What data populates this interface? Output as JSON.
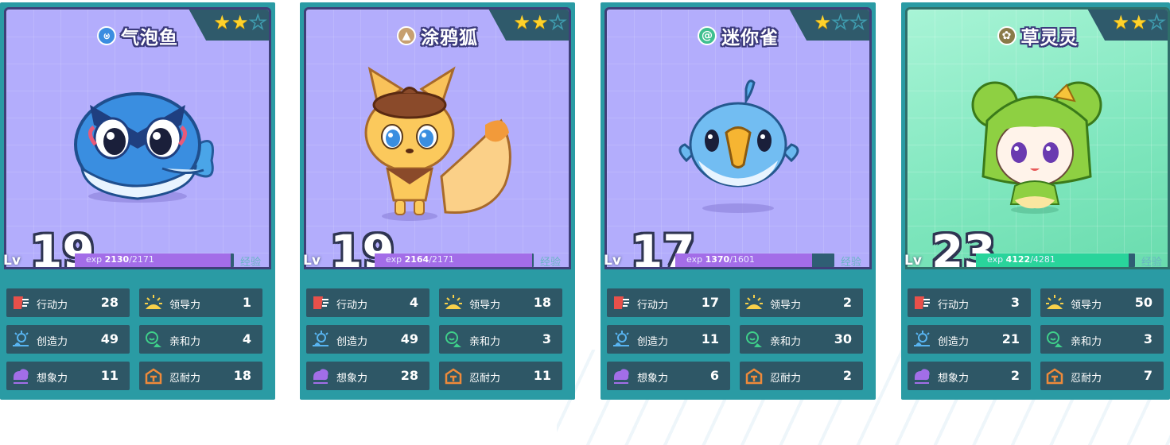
{
  "labels": {
    "lv": "Lv",
    "exp": "exp",
    "exp_side": "经验"
  },
  "stat_names": {
    "action": "行动力",
    "lead": "领导力",
    "create": "创造力",
    "affinity": "亲和力",
    "imagine": "想象力",
    "endure": "忍耐力"
  },
  "cards": [
    {
      "name": "气泡鱼",
      "type_icon": "water-swirl-icon",
      "type_color": "#3b8de0",
      "stars_filled": 2,
      "stars_total": 3,
      "level": "19",
      "exp_current": "2130",
      "exp_sep": "/",
      "exp_max": "2171",
      "exp_fraction": 0.98,
      "theme": "purple",
      "stats": {
        "action": "28",
        "lead": "1",
        "create": "49",
        "affinity": "4",
        "imagine": "11",
        "endure": "18"
      }
    },
    {
      "name": "涂鸦狐",
      "type_icon": "ground-icon",
      "type_color": "#c7a070",
      "stars_filled": 2,
      "stars_total": 3,
      "level": "19",
      "exp_current": "2164",
      "exp_sep": "/",
      "exp_max": "2171",
      "exp_fraction": 0.99,
      "theme": "purple",
      "stats": {
        "action": "4",
        "lead": "18",
        "create": "49",
        "affinity": "3",
        "imagine": "28",
        "endure": "11"
      }
    },
    {
      "name": "迷你雀",
      "type_icon": "wind-icon",
      "type_color": "#3fbf8f",
      "stars_filled": 1,
      "stars_total": 3,
      "level": "17",
      "exp_current": "1370",
      "exp_sep": "/",
      "exp_max": "1601",
      "exp_fraction": 0.86,
      "theme": "purple",
      "stats": {
        "action": "17",
        "lead": "2",
        "create": "11",
        "affinity": "30",
        "imagine": "6",
        "endure": "2"
      }
    },
    {
      "name": "草灵灵",
      "type_icon": "leaf-icon",
      "type_color": "#8a7a48",
      "stars_filled": 2,
      "stars_total": 3,
      "level": "23",
      "exp_current": "4122",
      "exp_sep": "/",
      "exp_max": "4281",
      "exp_fraction": 0.96,
      "theme": "green",
      "stats": {
        "action": "3",
        "lead": "50",
        "create": "21",
        "affinity": "3",
        "imagine": "2",
        "endure": "7"
      }
    }
  ]
}
